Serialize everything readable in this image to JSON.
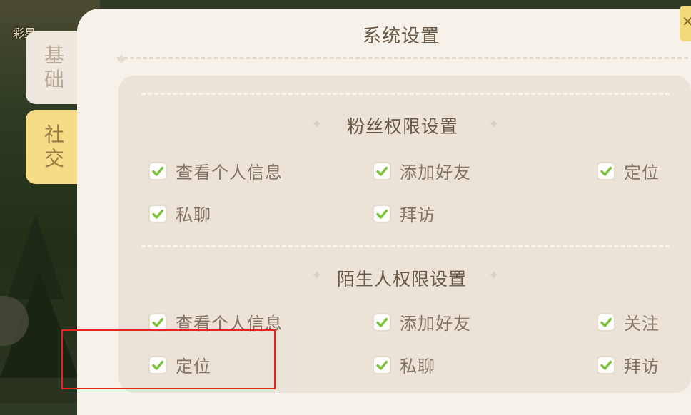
{
  "background": {
    "label": "彩星"
  },
  "side_tabs": [
    {
      "label": "基础",
      "chars": [
        "基",
        "础"
      ],
      "active": false
    },
    {
      "label": "社交",
      "chars": [
        "社",
        "交"
      ],
      "active": true
    }
  ],
  "panel": {
    "title": "系统设置"
  },
  "fan_section": {
    "title": "粉丝权限设置",
    "options": [
      {
        "label": "查看个人信息",
        "checked": true
      },
      {
        "label": "添加好友",
        "checked": true
      },
      {
        "label": "定位",
        "checked": true
      },
      {
        "label": "私聊",
        "checked": true
      },
      {
        "label": "拜访",
        "checked": true
      }
    ]
  },
  "stranger_section": {
    "title": "陌生人权限设置",
    "options": [
      {
        "label": "查看个人信息",
        "checked": true
      },
      {
        "label": "添加好友",
        "checked": true
      },
      {
        "label": "关注",
        "checked": true
      },
      {
        "label": "定位",
        "checked": true
      },
      {
        "label": "私聊",
        "checked": true
      },
      {
        "label": "拜访",
        "checked": true
      }
    ]
  },
  "colors": {
    "check_green": "#7cc23b",
    "highlight_red": "#e5251f",
    "active_tab": "#f6dc86"
  }
}
